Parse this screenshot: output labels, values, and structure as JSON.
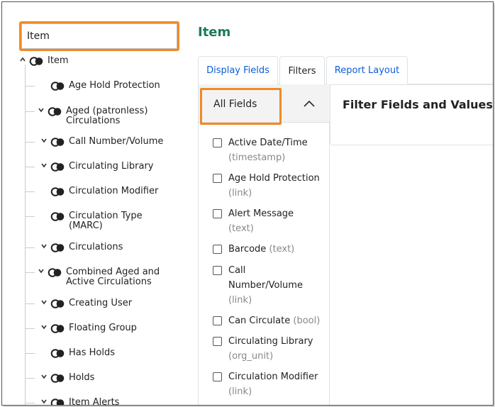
{
  "search": {
    "value": "Item"
  },
  "page": {
    "title": "Item"
  },
  "tabs": [
    {
      "label": "Display Fields"
    },
    {
      "label": "Filters"
    },
    {
      "label": "Report Layout"
    }
  ],
  "tree": {
    "root": {
      "label": "Item"
    },
    "nodes": [
      {
        "label": "Age Hold Protection",
        "expandable": false
      },
      {
        "label": "Aged (patronless)",
        "label2": "Circulations",
        "expandable": true
      },
      {
        "label": "Call Number/Volume",
        "expandable": true
      },
      {
        "label": "Circulating Library",
        "expandable": true
      },
      {
        "label": "Circulation Modifier",
        "expandable": false
      },
      {
        "label": "Circulation Type",
        "label2": "(MARC)",
        "expandable": false
      },
      {
        "label": "Circulations",
        "expandable": true
      },
      {
        "label": "Combined Aged and",
        "label2": "Active Circulations",
        "expandable": true
      },
      {
        "label": "Creating User",
        "expandable": true
      },
      {
        "label": "Floating Group",
        "expandable": true
      },
      {
        "label": "Has Holds",
        "expandable": false
      },
      {
        "label": "Holds",
        "expandable": true
      },
      {
        "label": "Item Alerts",
        "expandable": true
      }
    ]
  },
  "fields_panel": {
    "header": "All Fields"
  },
  "fields": [
    {
      "name": "Active Date/Time",
      "type": "(timestamp)"
    },
    {
      "name": "Age Hold Protection",
      "type": "(link)"
    },
    {
      "name": "Alert Message",
      "type": "(text)"
    },
    {
      "name": "Barcode",
      "type": "(text)"
    },
    {
      "name": "Call Number/Volume",
      "type": "(link)"
    },
    {
      "name": "Can Circulate",
      "type": "(bool)"
    },
    {
      "name": "Circulating Library",
      "type": "(org_unit)"
    },
    {
      "name": "Circulation Modifier",
      "type": "(link)"
    }
  ],
  "filter_panel": {
    "title": "Filter Fields and Values"
  },
  "colors": {
    "accent_title": "#1e7a5a",
    "link": "#0b5ed7",
    "highlight": "#f08a24"
  },
  "icons": {
    "relation": "relation-icon",
    "expand": "chevron-down-icon",
    "collapse": "chevron-up-icon"
  }
}
